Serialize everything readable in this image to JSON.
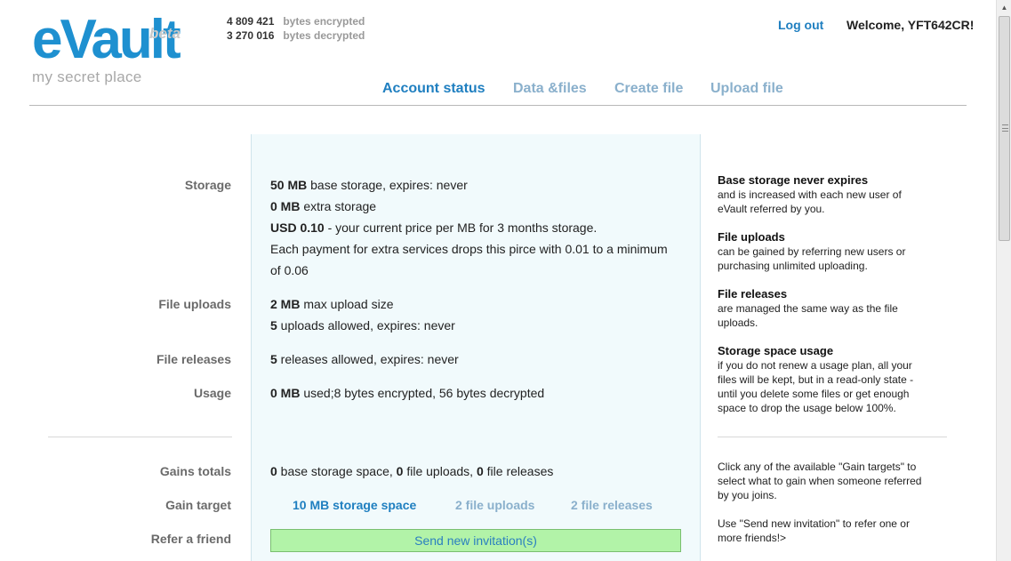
{
  "logo": {
    "main": "eVault",
    "badge": "beta",
    "tagline": "my secret place"
  },
  "stats": [
    {
      "value": "4 809 421",
      "label": "bytes encrypted"
    },
    {
      "value": "3 270 016",
      "label": "bytes decrypted"
    }
  ],
  "header": {
    "logout": "Log out",
    "welcome": "Welcome, YFT642CR!"
  },
  "nav": {
    "tabs": [
      {
        "label": "Account status",
        "active": true
      },
      {
        "label": "Data &files",
        "active": false
      },
      {
        "label": "Create file",
        "active": false
      },
      {
        "label": "Upload file",
        "active": false
      }
    ]
  },
  "rows": {
    "storage": {
      "label": "Storage",
      "lines": [
        {
          "bold": "50 MB",
          "text": " base storage, expires: never"
        },
        {
          "bold": "0 MB",
          "text": " extra storage"
        },
        {
          "bold": "USD 0.10",
          "text": " - your current price per MB for 3 months storage."
        },
        {
          "bold": "",
          "text": "Each payment for extra services drops this pirce with 0.01 to a minimum"
        },
        {
          "bold": "",
          "text": "of 0.06"
        }
      ]
    },
    "file_uploads": {
      "label": "File uploads",
      "lines": [
        {
          "bold": "2 MB",
          "text": " max upload size"
        },
        {
          "bold": "5",
          "text": " uploads allowed, expires: never"
        }
      ]
    },
    "file_releases": {
      "label": "File releases",
      "lines": [
        {
          "bold": "5",
          "text": " releases allowed, expires: never"
        }
      ]
    },
    "usage": {
      "label": "Usage",
      "lines": [
        {
          "bold": "0 MB",
          "text": " used;8 bytes encrypted, 56 bytes decrypted"
        }
      ]
    },
    "gains_totals": {
      "label": "Gains totals",
      "parts": [
        {
          "bold": "0",
          "text": " base storage space, "
        },
        {
          "bold": "0",
          "text": " file uploads, "
        },
        {
          "bold": "0",
          "text": " file releases"
        }
      ]
    },
    "gain_target": {
      "label": "Gain target",
      "options": [
        {
          "label": "10 MB storage space",
          "selected": true
        },
        {
          "label": "2 file uploads",
          "selected": false
        },
        {
          "label": "2 file releases",
          "selected": false
        }
      ]
    },
    "refer": {
      "label": "Refer a friend",
      "button": "Send new invitation(s)"
    }
  },
  "side": {
    "sections": [
      {
        "title": "Base storage never expires",
        "body": [
          "and is increased with each new user of",
          "eVault referred by you."
        ]
      },
      {
        "title": "File uploads",
        "body": [
          "can be gained by referring new users or",
          "purchasing unlimited uploading."
        ]
      },
      {
        "title": "File releases",
        "body": [
          "are managed the same way as the file",
          "uploads."
        ]
      },
      {
        "title": "Storage space usage",
        "body": [
          "if you do not renew a usage plan, all your",
          "files will be kept, but in a read-only state -",
          "until you delete some files or get enough",
          "space to drop the usage below 100%."
        ]
      }
    ],
    "gain_help": [
      "Click any of the available \"Gain targets\" to",
      "select what to gain when someone referred",
      "by you joins."
    ],
    "refer_help": [
      "Use \"Send new invitation\" to refer one or",
      "more friends!>"
    ]
  },
  "scrollbar": {
    "up_arrow_icon": "triangle-up"
  }
}
